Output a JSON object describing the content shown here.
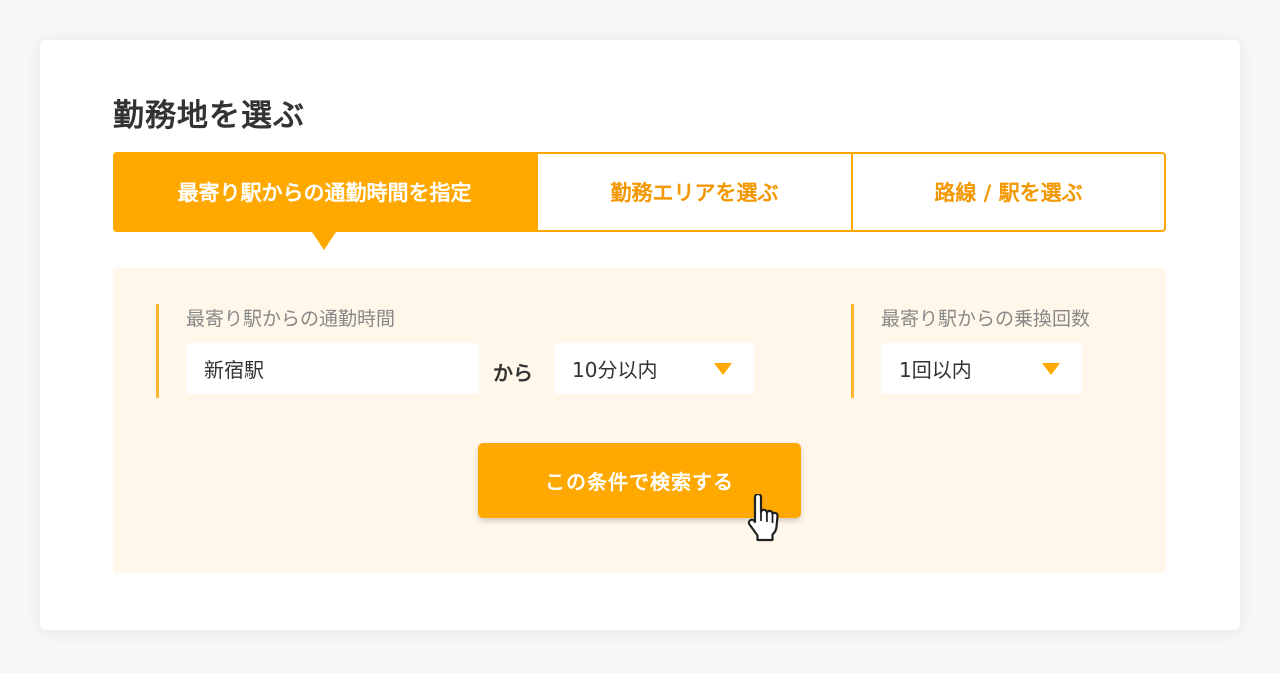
{
  "page": {
    "title": "勤務地を選ぶ"
  },
  "tabs": [
    {
      "label": "最寄り駅からの通勤時間を指定",
      "active": true
    },
    {
      "label": "勤務エリアを選ぶ",
      "active": false
    },
    {
      "label": "路線 / 駅を選ぶ",
      "active": false
    }
  ],
  "commute": {
    "label": "最寄り駅からの通勤時間",
    "station_value": "新宿駅",
    "connector": "から",
    "time_value": "10分以内"
  },
  "transfer": {
    "label": "最寄り駅からの乗換回数",
    "value": "1回以内"
  },
  "search_button": {
    "label": "この条件で検索する"
  },
  "icons": {
    "dropdown": "triangle-down-icon",
    "cursor": "pointer-hand-icon"
  },
  "colors": {
    "accent": "#ffa800",
    "accent_text": "#f39800",
    "panel_bg": "#fff7e9"
  }
}
